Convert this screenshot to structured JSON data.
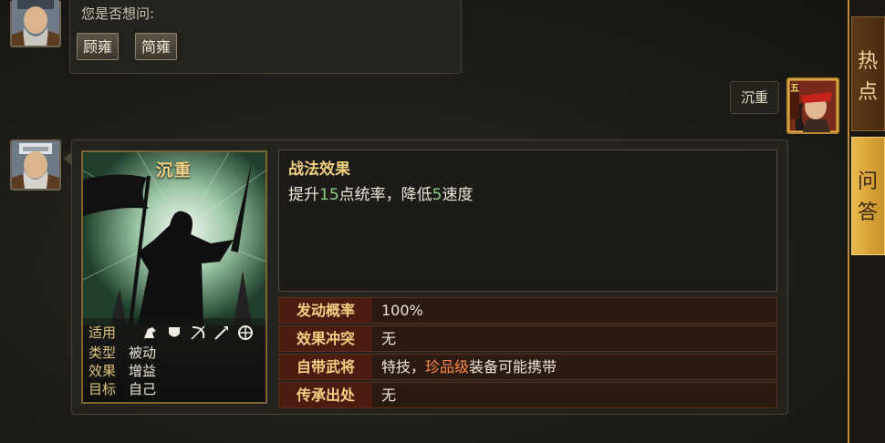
{
  "chat": {
    "top_question": "您是否想问:",
    "suggestions": [
      "顾雍",
      "简雍"
    ],
    "user_message": "沉重"
  },
  "skill_card": {
    "name": "沉重",
    "applies_label": "适用",
    "troop_icons": [
      "cavalry-icon",
      "shield-icon",
      "bow-icon",
      "spear-icon",
      "vehicle-icon"
    ],
    "rows": [
      {
        "label": "类型",
        "value": "被动"
      },
      {
        "label": "效果",
        "value": "增益"
      },
      {
        "label": "目标",
        "value": "自己"
      }
    ]
  },
  "effect": {
    "title": "战法效果",
    "desc_1": "提升",
    "num_1": "15",
    "desc_2": "点统率，降低",
    "num_2": "5",
    "desc_3": "速度"
  },
  "info": {
    "trigger_label": "发动概率",
    "trigger_value": "100%",
    "conflict_label": "效果冲突",
    "conflict_value": "无",
    "general_label": "自带武将",
    "general_value_1": "特技，",
    "general_value_2": "珍品级",
    "general_value_3": "装备可能携带",
    "inherit_label": "传承出处",
    "inherit_value": "无"
  },
  "user_badge": "五",
  "tabs": {
    "hot": [
      "热",
      "点"
    ],
    "qa": [
      "问",
      "答"
    ]
  },
  "colors": {
    "gold": "#f0cf80",
    "green": "#8fd08a",
    "orange": "#ff8a3d",
    "tab_active": "#e9b84a"
  }
}
